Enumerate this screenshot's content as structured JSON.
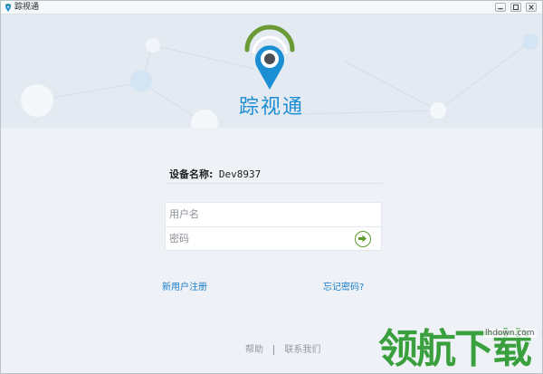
{
  "window": {
    "title": "踪视通",
    "controls": [
      "minimize",
      "maximize",
      "close"
    ]
  },
  "header": {
    "brand_name": "踪视通",
    "logo_icon": "location-pin-signal-icon",
    "colors": {
      "brand_blue": "#1c8ed4",
      "signal_green": "#6a9a36"
    }
  },
  "device": {
    "label": "设备名称:",
    "value": "Dev8937"
  },
  "login": {
    "username_placeholder": "用户名",
    "password_placeholder": "密码",
    "submit_icon": "arrow-right-icon"
  },
  "links": {
    "register": "新用户注册",
    "forgot": "忘记密码?"
  },
  "footer": {
    "help": "帮助",
    "contact": "联系我们"
  },
  "watermark": {
    "text": "领航下载",
    "url": "lhdown.com"
  }
}
